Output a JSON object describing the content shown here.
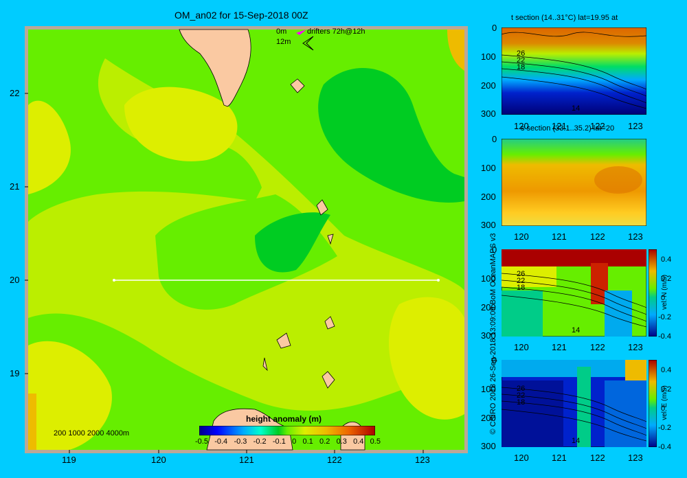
{
  "title": "OM_an02 for 15-Sep-2018 00Z",
  "colors": {
    "background": "#00ccff",
    "frame": "#bba898",
    "land": "#fac9a2",
    "land_edge": "#a89a8c",
    "green_dark": "#00cc22",
    "green": "#66ee00",
    "yellow_green": "#bbee00",
    "yellow": "#ddee00",
    "orange": "#eebb00"
  },
  "map": {
    "x_ticks": [
      "119",
      "120",
      "121",
      "122",
      "123"
    ],
    "y_ticks": [
      "22",
      "21",
      "20",
      "19"
    ],
    "depth_legend": "200  1000  2000  4000m",
    "legend_0m": "0m",
    "legend_12m": "12m",
    "drifters_label": "drifters 72h@12h",
    "section_line_lat": 20,
    "section_line_lon": [
      119.5,
      123.2
    ]
  },
  "colorbar": {
    "title": "height anomaly (m)",
    "ticks": [
      "-0.5",
      "-0.4",
      "-0.3",
      "-0.2",
      "-0.1",
      "0",
      "0.1",
      "0.2",
      "0.3",
      "0.4",
      "0.5"
    ]
  },
  "sections": [
    {
      "title": "t section (14..31°C) lat=19.95 at",
      "y_ticks": [
        "0",
        "100",
        "200",
        "300"
      ],
      "x_ticks": [
        "120",
        "121",
        "122",
        "123"
      ],
      "labels": [
        "26",
        "22",
        "18",
        "14"
      ]
    },
    {
      "title": "s section (33.1..35.2) lat=20",
      "y_ticks": [
        "0",
        "100",
        "200",
        "300"
      ],
      "x_ticks": [
        "120",
        "121",
        "122",
        "123"
      ]
    },
    {
      "title": "",
      "y_ticks": [
        "0",
        "100",
        "200",
        "300"
      ],
      "x_ticks": [
        "120",
        "121",
        "122",
        "123"
      ],
      "cb_ticks": [
        "0.4",
        "0.2",
        "0",
        "-0.2",
        "-0.4"
      ],
      "cb_label": "vel. N (m/s)",
      "labels": [
        "26",
        "22",
        "18",
        "14"
      ]
    },
    {
      "title": "",
      "y_ticks": [
        "0",
        "100",
        "200",
        "300"
      ],
      "x_ticks": [
        "120",
        "121",
        "122",
        "123"
      ],
      "cb_ticks": [
        "0.4",
        "0.2",
        "0",
        "-0.2",
        "-0.4"
      ],
      "cb_label": "vel. E (m/s)",
      "labels": [
        "26",
        "22",
        "18",
        "14"
      ]
    }
  ],
  "credits": "© CSIRO 2018   26-Sep-2018 13:09:09 BoM OceanMAPS v3",
  "chart_data": {
    "type": "heatmap",
    "title": "OM_an02 for 15-Sep-2018 00Z",
    "xlim": [
      118.5,
      123.5
    ],
    "ylim": [
      18.3,
      22.7
    ],
    "colorbar_range": [
      -0.5,
      0.5
    ],
    "colorbar_label": "height anomaly (m)"
  }
}
